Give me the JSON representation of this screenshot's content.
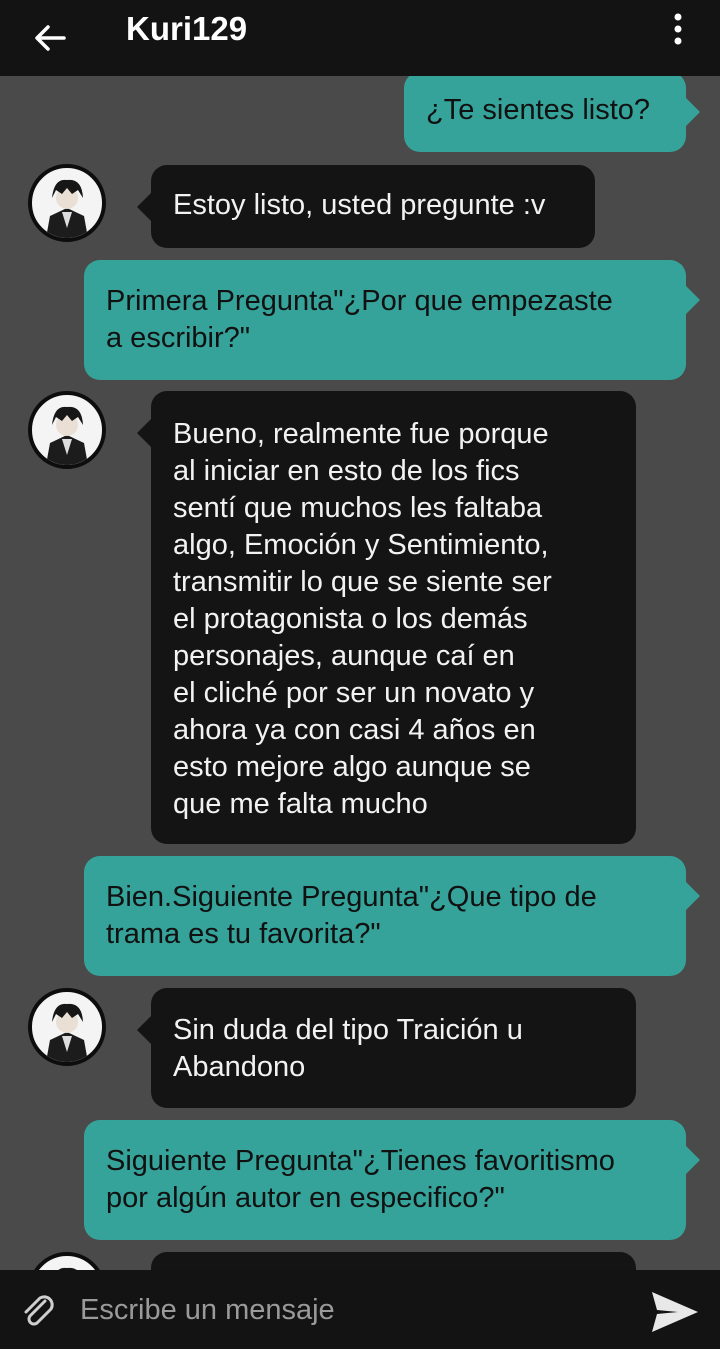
{
  "header": {
    "title": "Kuri129"
  },
  "messages": [
    {
      "side": "out",
      "text": "¿Te sientes listo?"
    },
    {
      "side": "in",
      "text": "Estoy listo, usted pregunte :v"
    },
    {
      "side": "out",
      "line1": "Primera Pregunta\"¿Por que empezaste",
      "line2": "a escribir?\""
    },
    {
      "side": "in",
      "lines": [
        "Bueno, realmente fue porque",
        "al iniciar en esto de los fics",
        "sentí que muchos les faltaba",
        "algo, Emoción y Sentimiento,",
        "transmitir lo que se siente ser",
        "el protagonista o los demás",
        "personajes, aunque caí en",
        "el cliché por ser un novato y",
        "ahora ya con casi 4 años en",
        "esto mejore algo aunque se",
        "que me falta mucho"
      ]
    },
    {
      "side": "out",
      "line1": "Bien.Siguiente Pregunta\"¿Que tipo de",
      "line2": "trama es tu favorita?\""
    },
    {
      "side": "in",
      "line1": "Sin duda del tipo Traición u",
      "line2": "Abandono"
    },
    {
      "side": "out",
      "line1": "Siguiente Pregunta\"¿Tienes favoritismo",
      "line2": "por algún autor en especifico?\""
    }
  ],
  "composer": {
    "placeholder": "Escribe un mensaje"
  },
  "icons": {
    "back": "arrow-left-icon",
    "menu": "kebab-menu-icon",
    "attach": "paperclip-icon",
    "send": "send-icon"
  }
}
